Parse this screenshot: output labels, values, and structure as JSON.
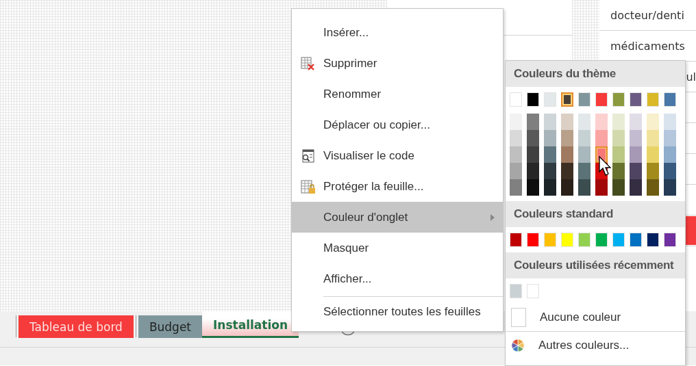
{
  "sheet": {
    "cells": [
      {
        "text": "docteur/denti"
      },
      {
        "text": "médicaments"
      },
      {
        "text": "ul"
      }
    ]
  },
  "sheet_tabs": [
    {
      "label": "Tableau de bord",
      "color": "#f53b3b",
      "selected": false
    },
    {
      "label": "Budget",
      "color": "#7f979c",
      "selected": false
    },
    {
      "label": "Installation",
      "color": "#f6c3c3",
      "selected": true
    }
  ],
  "context_menu": {
    "items": [
      {
        "label": "Insérer...",
        "kind": "plain",
        "submenu": false,
        "highlighted": false,
        "separator_before": false
      },
      {
        "label": "Supprimer",
        "kind": "delete",
        "submenu": false,
        "highlighted": false,
        "separator_before": false
      },
      {
        "label": "Renommer",
        "kind": "plain",
        "submenu": false,
        "highlighted": false,
        "separator_before": false
      },
      {
        "label": "Déplacer ou copier...",
        "kind": "plain",
        "submenu": false,
        "highlighted": false,
        "separator_before": false
      },
      {
        "label": "Visualiser le code",
        "kind": "code",
        "submenu": false,
        "highlighted": false,
        "separator_before": false
      },
      {
        "label": "Protéger la feuille...",
        "kind": "protect",
        "submenu": false,
        "highlighted": false,
        "separator_before": false
      },
      {
        "label": "Couleur d'onglet",
        "kind": "plain",
        "submenu": true,
        "highlighted": true,
        "separator_before": false
      },
      {
        "label": "Masquer",
        "kind": "plain",
        "submenu": false,
        "highlighted": false,
        "separator_before": false
      },
      {
        "label": "Afficher...",
        "kind": "plain",
        "submenu": false,
        "highlighted": false,
        "separator_before": false
      },
      {
        "label": "Sélectionner toutes les feuilles",
        "kind": "plain",
        "submenu": false,
        "highlighted": false,
        "separator_before": true
      }
    ]
  },
  "color_menu": {
    "sections": [
      {
        "title": "Couleurs du thème",
        "kind": "theme",
        "rows": [
          [
            {
              "color": "#ffffff",
              "highlighted": false
            },
            {
              "color": "#000000",
              "highlighted": false
            },
            {
              "color": "#e3e8ea",
              "highlighted": false
            },
            {
              "color": "#4a3f35",
              "highlighted": true
            },
            {
              "color": "#7f979c",
              "highlighted": false
            },
            {
              "color": "#f73a3a",
              "highlighted": false
            },
            {
              "color": "#8b9a3e",
              "highlighted": false
            },
            {
              "color": "#6b5b84",
              "highlighted": false
            },
            {
              "color": "#d9b928",
              "highlighted": false
            },
            {
              "color": "#4a78a8",
              "highlighted": false
            }
          ],
          [
            {
              "color": "#f2f2f2",
              "highlighted": false
            },
            {
              "color": "#7f7f7f",
              "highlighted": false
            },
            {
              "color": "#cfd6d9",
              "highlighted": false
            },
            {
              "color": "#dccfc4",
              "highlighted": false
            },
            {
              "color": "#e2e8e9",
              "highlighted": false
            },
            {
              "color": "#fdd0d0",
              "highlighted": false
            },
            {
              "color": "#e8ecd5",
              "highlighted": false
            },
            {
              "color": "#e1dde7",
              "highlighted": false
            },
            {
              "color": "#f8f0cc",
              "highlighted": false
            },
            {
              "color": "#d9e3ee",
              "highlighted": false
            }
          ],
          [
            {
              "color": "#d9d9d9",
              "highlighted": false
            },
            {
              "color": "#595959",
              "highlighted": false
            },
            {
              "color": "#a7b4ba",
              "highlighted": false
            },
            {
              "color": "#b8a08a",
              "highlighted": false
            },
            {
              "color": "#c6d1d3",
              "highlighted": false
            },
            {
              "color": "#fba4a4",
              "highlighted": false
            },
            {
              "color": "#d2daad",
              "highlighted": false
            },
            {
              "color": "#c3bbcf",
              "highlighted": false
            },
            {
              "color": "#f0e29a",
              "highlighted": false
            },
            {
              "color": "#b4c7dd",
              "highlighted": false
            }
          ],
          [
            {
              "color": "#bfbfbf",
              "highlighted": false
            },
            {
              "color": "#404040",
              "highlighted": false
            },
            {
              "color": "#5f7680",
              "highlighted": false
            },
            {
              "color": "#a07a60",
              "highlighted": false
            },
            {
              "color": "#a8b8bc",
              "highlighted": false
            },
            {
              "color": "#f77777",
              "highlighted": true
            },
            {
              "color": "#bbc883",
              "highlighted": false
            },
            {
              "color": "#a599b6",
              "highlighted": false
            },
            {
              "color": "#e8d466",
              "highlighted": false
            },
            {
              "color": "#8eaccb",
              "highlighted": false
            }
          ],
          [
            {
              "color": "#a6a6a6",
              "highlighted": false
            },
            {
              "color": "#262626",
              "highlighted": false
            },
            {
              "color": "#2f3b40",
              "highlighted": false
            },
            {
              "color": "#3d2f22",
              "highlighted": false
            },
            {
              "color": "#5b7376",
              "highlighted": false
            },
            {
              "color": "#d90b0b",
              "highlighted": false
            },
            {
              "color": "#68742e",
              "highlighted": false
            },
            {
              "color": "#504463",
              "highlighted": false
            },
            {
              "color": "#a38b1b",
              "highlighted": false
            },
            {
              "color": "#375a7e",
              "highlighted": false
            }
          ],
          [
            {
              "color": "#808080",
              "highlighted": false
            },
            {
              "color": "#0d0d0d",
              "highlighted": false
            },
            {
              "color": "#1c2427",
              "highlighted": false
            },
            {
              "color": "#2a2019",
              "highlighted": false
            },
            {
              "color": "#3c4d4f",
              "highlighted": false
            },
            {
              "color": "#a30808",
              "highlighted": false
            },
            {
              "color": "#454d1f",
              "highlighted": false
            },
            {
              "color": "#352d42",
              "highlighted": false
            },
            {
              "color": "#6d5c12",
              "highlighted": false
            },
            {
              "color": "#253c54",
              "highlighted": false
            }
          ]
        ]
      },
      {
        "title": "Couleurs standard",
        "kind": "plain",
        "rows": [
          [
            {
              "color": "#c00000",
              "highlighted": false
            },
            {
              "color": "#ff0000",
              "highlighted": false
            },
            {
              "color": "#ffc000",
              "highlighted": false
            },
            {
              "color": "#ffff00",
              "highlighted": false
            },
            {
              "color": "#92d050",
              "highlighted": false
            },
            {
              "color": "#00b050",
              "highlighted": false
            },
            {
              "color": "#00b0f0",
              "highlighted": false
            },
            {
              "color": "#0070c0",
              "highlighted": false
            },
            {
              "color": "#002060",
              "highlighted": false
            },
            {
              "color": "#7030a0",
              "highlighted": false
            }
          ]
        ]
      },
      {
        "title": "Couleurs utilisées récemment",
        "kind": "plain",
        "rows": [
          [
            {
              "color": "#c9d1d4",
              "highlighted": false
            },
            {
              "color": "#ffffff",
              "highlighted": false
            }
          ]
        ]
      }
    ],
    "no_color": {
      "label": "Aucune couleur"
    },
    "more_colors": {
      "label": "Autres couleurs..."
    }
  }
}
